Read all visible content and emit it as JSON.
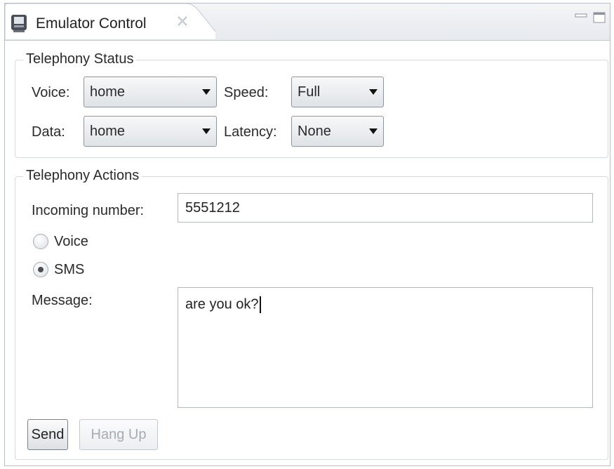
{
  "tab": {
    "title": "Emulator Control",
    "icon": "emulator-icon",
    "close_icon": "close-icon"
  },
  "window_controls": {
    "minimize_icon": "minimize-icon",
    "maximize_icon": "maximize-icon"
  },
  "telephony_status": {
    "title": "Telephony Status",
    "voice_label": "Voice:",
    "voice_value": "home",
    "speed_label": "Speed:",
    "speed_value": "Full",
    "data_label": "Data:",
    "data_value": "home",
    "latency_label": "Latency:",
    "latency_value": "None"
  },
  "telephony_actions": {
    "title": "Telephony Actions",
    "incoming_label": "Incoming number:",
    "incoming_value": "5551212",
    "radio_voice": "Voice",
    "radio_sms": "SMS",
    "selected_radio": "SMS",
    "message_label": "Message:",
    "message_value": "are you ok?",
    "send_label": "Send",
    "hangup_label": "Hang Up"
  },
  "colors": {
    "border": "#b9bec6",
    "tab_bg": "#f4f5f7",
    "disabled_text": "#a7abb1"
  }
}
